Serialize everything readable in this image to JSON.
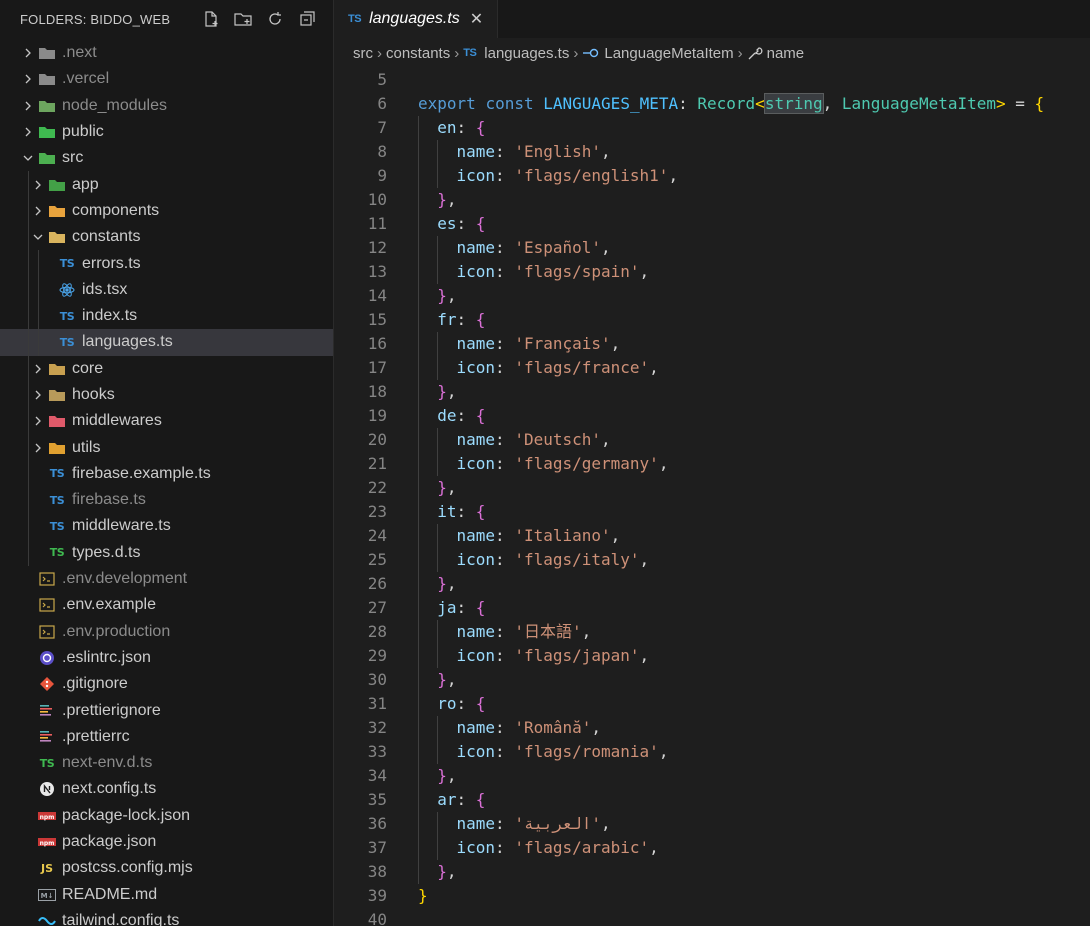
{
  "explorer": {
    "title": "FOLDERS: BIDDO_WEB",
    "items": [
      {
        "label": ".next",
        "depth": 0,
        "kind": "folder",
        "expanded": false,
        "icon": "next-folder-icon",
        "dim": true
      },
      {
        "label": ".vercel",
        "depth": 0,
        "kind": "folder",
        "expanded": false,
        "icon": "vercel-folder-icon",
        "dim": true
      },
      {
        "label": "node_modules",
        "depth": 0,
        "kind": "folder",
        "expanded": false,
        "icon": "node-folder-icon",
        "dim": true
      },
      {
        "label": "public",
        "depth": 0,
        "kind": "folder",
        "expanded": false,
        "icon": "public-folder-icon",
        "dim": false
      },
      {
        "label": "src",
        "depth": 0,
        "kind": "folder",
        "expanded": true,
        "icon": "src-folder-icon",
        "dim": false
      },
      {
        "label": "app",
        "depth": 1,
        "kind": "folder",
        "expanded": false,
        "icon": "app-folder-icon",
        "dim": false
      },
      {
        "label": "components",
        "depth": 1,
        "kind": "folder",
        "expanded": false,
        "icon": "components-folder-icon",
        "dim": false
      },
      {
        "label": "constants",
        "depth": 1,
        "kind": "folder",
        "expanded": true,
        "icon": "constants-folder-icon",
        "dim": false
      },
      {
        "label": "errors.ts",
        "depth": 2,
        "kind": "ts",
        "icon": "typescript-icon",
        "dim": false
      },
      {
        "label": "ids.tsx",
        "depth": 2,
        "kind": "react",
        "icon": "react-icon",
        "dim": false
      },
      {
        "label": "index.ts",
        "depth": 2,
        "kind": "ts",
        "icon": "typescript-icon",
        "dim": false
      },
      {
        "label": "languages.ts",
        "depth": 2,
        "kind": "ts",
        "icon": "typescript-icon",
        "dim": false,
        "selected": true
      },
      {
        "label": "core",
        "depth": 1,
        "kind": "folder",
        "expanded": false,
        "icon": "core-folder-icon",
        "dim": false
      },
      {
        "label": "hooks",
        "depth": 1,
        "kind": "folder",
        "expanded": false,
        "icon": "hooks-folder-icon",
        "dim": false
      },
      {
        "label": "middlewares",
        "depth": 1,
        "kind": "folder",
        "expanded": false,
        "icon": "middlewares-folder-icon",
        "dim": false
      },
      {
        "label": "utils",
        "depth": 1,
        "kind": "folder",
        "expanded": false,
        "icon": "utils-folder-icon",
        "dim": false
      },
      {
        "label": "firebase.example.ts",
        "depth": 1,
        "kind": "ts",
        "icon": "typescript-icon",
        "dim": false
      },
      {
        "label": "firebase.ts",
        "depth": 1,
        "kind": "ts",
        "icon": "typescript-icon",
        "dim": true
      },
      {
        "label": "middleware.ts",
        "depth": 1,
        "kind": "ts",
        "icon": "typescript-icon",
        "dim": false
      },
      {
        "label": "types.d.ts",
        "depth": 1,
        "kind": "tsd",
        "icon": "typescript-def-icon",
        "dim": false
      },
      {
        "label": ".env.development",
        "depth": 0,
        "kind": "env",
        "icon": "terminal-icon",
        "dim": true
      },
      {
        "label": ".env.example",
        "depth": 0,
        "kind": "env",
        "icon": "terminal-icon",
        "dim": false
      },
      {
        "label": ".env.production",
        "depth": 0,
        "kind": "env",
        "icon": "terminal-icon",
        "dim": true
      },
      {
        "label": ".eslintrc.json",
        "depth": 0,
        "kind": "eslint",
        "icon": "eslint-icon",
        "dim": false
      },
      {
        "label": ".gitignore",
        "depth": 0,
        "kind": "git",
        "icon": "git-icon",
        "dim": false
      },
      {
        "label": ".prettierignore",
        "depth": 0,
        "kind": "prettier",
        "icon": "prettier-icon",
        "dim": false
      },
      {
        "label": ".prettierrc",
        "depth": 0,
        "kind": "prettier",
        "icon": "prettier-icon",
        "dim": false
      },
      {
        "label": "next-env.d.ts",
        "depth": 0,
        "kind": "tsd",
        "icon": "typescript-def-icon",
        "dim": true
      },
      {
        "label": "next.config.ts",
        "depth": 0,
        "kind": "next",
        "icon": "nextjs-icon",
        "dim": false
      },
      {
        "label": "package-lock.json",
        "depth": 0,
        "kind": "npm",
        "icon": "npm-icon",
        "dim": false
      },
      {
        "label": "package.json",
        "depth": 0,
        "kind": "npm",
        "icon": "npm-icon",
        "dim": false
      },
      {
        "label": "postcss.config.mjs",
        "depth": 0,
        "kind": "js",
        "icon": "javascript-icon",
        "dim": false
      },
      {
        "label": "README.md",
        "depth": 0,
        "kind": "md",
        "icon": "markdown-icon",
        "dim": false
      },
      {
        "label": "tailwind.config.ts",
        "depth": 0,
        "kind": "tailwind",
        "icon": "tailwind-icon",
        "dim": false
      }
    ]
  },
  "tab": {
    "badge": "TS",
    "title": "languages.ts",
    "close": "✕"
  },
  "breadcrumb": {
    "parts": [
      "src",
      "constants",
      "languages.ts",
      "LanguageMetaItem",
      "name"
    ],
    "badge": "TS"
  },
  "code": {
    "lines": [
      {
        "n": "5",
        "tokens": []
      },
      {
        "n": "6",
        "indent": 0,
        "tokens": [
          [
            "kw",
            "export"
          ],
          [
            "punc",
            " "
          ],
          [
            "decl",
            "const"
          ],
          [
            "punc",
            " "
          ],
          [
            "const",
            "LANGUAGES_META"
          ],
          [
            "punc",
            ": "
          ],
          [
            "type",
            "Record"
          ],
          [
            "b1",
            "<"
          ],
          [
            "hltype",
            "string"
          ],
          [
            "punc",
            ", "
          ],
          [
            "type",
            "LanguageMetaItem"
          ],
          [
            "b1",
            ">"
          ],
          [
            "punc",
            " = "
          ],
          [
            "b1",
            "{"
          ]
        ]
      },
      {
        "n": "7",
        "indent": 1,
        "tokens": [
          [
            "prop",
            "en"
          ],
          [
            "punc",
            ": "
          ],
          [
            "b2",
            "{"
          ]
        ]
      },
      {
        "n": "8",
        "indent": 2,
        "tokens": [
          [
            "prop",
            "name"
          ],
          [
            "punc",
            ": "
          ],
          [
            "str",
            "'English'"
          ],
          [
            "punc",
            ","
          ]
        ]
      },
      {
        "n": "9",
        "indent": 2,
        "tokens": [
          [
            "prop",
            "icon"
          ],
          [
            "punc",
            ": "
          ],
          [
            "str",
            "'flags/english1'"
          ],
          [
            "punc",
            ","
          ]
        ]
      },
      {
        "n": "10",
        "indent": 1,
        "tokens": [
          [
            "b2",
            "}"
          ],
          [
            "punc",
            ","
          ]
        ]
      },
      {
        "n": "11",
        "indent": 1,
        "tokens": [
          [
            "prop",
            "es"
          ],
          [
            "punc",
            ": "
          ],
          [
            "b2",
            "{"
          ]
        ]
      },
      {
        "n": "12",
        "indent": 2,
        "tokens": [
          [
            "prop",
            "name"
          ],
          [
            "punc",
            ": "
          ],
          [
            "str",
            "'Español'"
          ],
          [
            "punc",
            ","
          ]
        ]
      },
      {
        "n": "13",
        "indent": 2,
        "tokens": [
          [
            "prop",
            "icon"
          ],
          [
            "punc",
            ": "
          ],
          [
            "str",
            "'flags/spain'"
          ],
          [
            "punc",
            ","
          ]
        ]
      },
      {
        "n": "14",
        "indent": 1,
        "tokens": [
          [
            "b2",
            "}"
          ],
          [
            "punc",
            ","
          ]
        ]
      },
      {
        "n": "15",
        "indent": 1,
        "tokens": [
          [
            "prop",
            "fr"
          ],
          [
            "punc",
            ": "
          ],
          [
            "b2",
            "{"
          ]
        ]
      },
      {
        "n": "16",
        "indent": 2,
        "tokens": [
          [
            "prop",
            "name"
          ],
          [
            "punc",
            ": "
          ],
          [
            "str",
            "'Français'"
          ],
          [
            "punc",
            ","
          ]
        ]
      },
      {
        "n": "17",
        "indent": 2,
        "tokens": [
          [
            "prop",
            "icon"
          ],
          [
            "punc",
            ": "
          ],
          [
            "str",
            "'flags/france'"
          ],
          [
            "punc",
            ","
          ]
        ]
      },
      {
        "n": "18",
        "indent": 1,
        "tokens": [
          [
            "b2",
            "}"
          ],
          [
            "punc",
            ","
          ]
        ]
      },
      {
        "n": "19",
        "indent": 1,
        "tokens": [
          [
            "prop",
            "de"
          ],
          [
            "punc",
            ": "
          ],
          [
            "b2",
            "{"
          ]
        ]
      },
      {
        "n": "20",
        "indent": 2,
        "tokens": [
          [
            "prop",
            "name"
          ],
          [
            "punc",
            ": "
          ],
          [
            "str",
            "'Deutsch'"
          ],
          [
            "punc",
            ","
          ]
        ]
      },
      {
        "n": "21",
        "indent": 2,
        "tokens": [
          [
            "prop",
            "icon"
          ],
          [
            "punc",
            ": "
          ],
          [
            "str",
            "'flags/germany'"
          ],
          [
            "punc",
            ","
          ]
        ]
      },
      {
        "n": "22",
        "indent": 1,
        "tokens": [
          [
            "b2",
            "}"
          ],
          [
            "punc",
            ","
          ]
        ]
      },
      {
        "n": "23",
        "indent": 1,
        "tokens": [
          [
            "prop",
            "it"
          ],
          [
            "punc",
            ": "
          ],
          [
            "b2",
            "{"
          ]
        ]
      },
      {
        "n": "24",
        "indent": 2,
        "tokens": [
          [
            "prop",
            "name"
          ],
          [
            "punc",
            ": "
          ],
          [
            "str",
            "'Italiano'"
          ],
          [
            "punc",
            ","
          ]
        ]
      },
      {
        "n": "25",
        "indent": 2,
        "tokens": [
          [
            "prop",
            "icon"
          ],
          [
            "punc",
            ": "
          ],
          [
            "str",
            "'flags/italy'"
          ],
          [
            "punc",
            ","
          ]
        ]
      },
      {
        "n": "26",
        "indent": 1,
        "tokens": [
          [
            "b2",
            "}"
          ],
          [
            "punc",
            ","
          ]
        ]
      },
      {
        "n": "27",
        "indent": 1,
        "tokens": [
          [
            "prop",
            "ja"
          ],
          [
            "punc",
            ": "
          ],
          [
            "b2",
            "{"
          ]
        ]
      },
      {
        "n": "28",
        "indent": 2,
        "tokens": [
          [
            "prop",
            "name"
          ],
          [
            "punc",
            ": "
          ],
          [
            "str",
            "'日本語'"
          ],
          [
            "punc",
            ","
          ]
        ]
      },
      {
        "n": "29",
        "indent": 2,
        "tokens": [
          [
            "prop",
            "icon"
          ],
          [
            "punc",
            ": "
          ],
          [
            "str",
            "'flags/japan'"
          ],
          [
            "punc",
            ","
          ]
        ]
      },
      {
        "n": "30",
        "indent": 1,
        "tokens": [
          [
            "b2",
            "}"
          ],
          [
            "punc",
            ","
          ]
        ]
      },
      {
        "n": "31",
        "indent": 1,
        "tokens": [
          [
            "prop",
            "ro"
          ],
          [
            "punc",
            ": "
          ],
          [
            "b2",
            "{"
          ]
        ]
      },
      {
        "n": "32",
        "indent": 2,
        "tokens": [
          [
            "prop",
            "name"
          ],
          [
            "punc",
            ": "
          ],
          [
            "str",
            "'Română'"
          ],
          [
            "punc",
            ","
          ]
        ]
      },
      {
        "n": "33",
        "indent": 2,
        "tokens": [
          [
            "prop",
            "icon"
          ],
          [
            "punc",
            ": "
          ],
          [
            "str",
            "'flags/romania'"
          ],
          [
            "punc",
            ","
          ]
        ]
      },
      {
        "n": "34",
        "indent": 1,
        "tokens": [
          [
            "b2",
            "}"
          ],
          [
            "punc",
            ","
          ]
        ]
      },
      {
        "n": "35",
        "indent": 1,
        "tokens": [
          [
            "prop",
            "ar"
          ],
          [
            "punc",
            ": "
          ],
          [
            "b2",
            "{"
          ]
        ]
      },
      {
        "n": "36",
        "indent": 2,
        "tokens": [
          [
            "prop",
            "name"
          ],
          [
            "punc",
            ": "
          ],
          [
            "str",
            "'العربية'"
          ],
          [
            "punc",
            ","
          ]
        ]
      },
      {
        "n": "37",
        "indent": 2,
        "tokens": [
          [
            "prop",
            "icon"
          ],
          [
            "punc",
            ": "
          ],
          [
            "str",
            "'flags/arabic'"
          ],
          [
            "punc",
            ","
          ]
        ]
      },
      {
        "n": "38",
        "indent": 1,
        "tokens": [
          [
            "b2",
            "}"
          ],
          [
            "punc",
            ","
          ]
        ]
      },
      {
        "n": "39",
        "indent": 0,
        "tokens": [
          [
            "b1",
            "}"
          ]
        ]
      },
      {
        "n": "40",
        "tokens": []
      }
    ]
  },
  "colors": {
    "accent": "#3b8fd6",
    "selection": "#37373d",
    "background": "#1e1e1e",
    "sidebar": "#181818"
  }
}
